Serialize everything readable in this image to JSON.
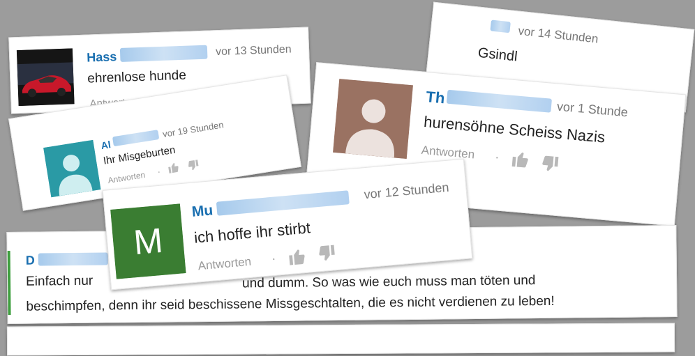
{
  "comments": {
    "c1": {
      "name": "Hass",
      "time": "vor 13 Stunden",
      "text": "ehrenlose hunde",
      "reply": "Antworten"
    },
    "c2": {
      "time": "vor 14 Stunden",
      "text": "Gsindl"
    },
    "c3": {
      "name": "Al",
      "time": "vor 19 Stunden",
      "text": "Ihr Misgeburten",
      "reply": "Antworten",
      "dot": "·"
    },
    "c4": {
      "name": "Th",
      "time": "vor 1 Stunde",
      "text": "hurensöhne Scheiss Nazis",
      "reply": "Antworten",
      "dot": "·"
    },
    "c5": {
      "name": "Mu",
      "time": "vor 12 Stunden",
      "text": "ich hoffe ihr stirbt",
      "reply": "Antworten",
      "dot": "·",
      "avatar_letter": "M"
    },
    "c6": {
      "name": "D",
      "line1_start": "Einfach nur",
      "line1_end": "und dumm. So was wie euch muss man töten und",
      "line2": "beschimpfen, denn ihr seid beschissene Missgeschtalten, die es nicht verdienen zu leben!"
    }
  },
  "colors": {
    "background": "#9c9c9c",
    "name": "#1a6fb0",
    "avatar_green": "#3a7d32",
    "avatar_teal": "#2a9aa5",
    "avatar_brown": "#9a7262",
    "accent_bar": "#3f9f3f"
  }
}
